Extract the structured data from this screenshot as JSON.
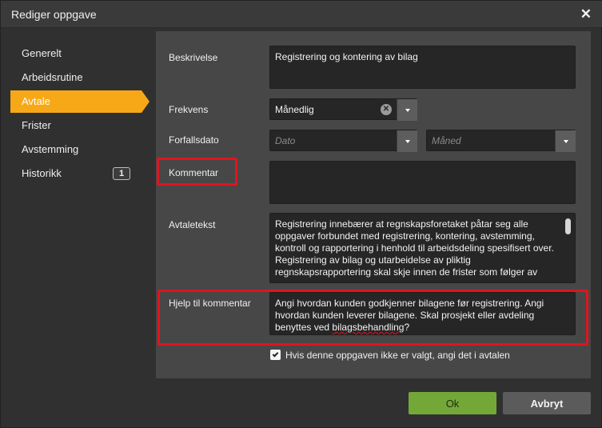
{
  "dialog": {
    "title": "Rediger oppgave"
  },
  "sidebar": {
    "items": [
      {
        "label": "Generelt"
      },
      {
        "label": "Arbeidsrutine"
      },
      {
        "label": "Avtale"
      },
      {
        "label": "Frister"
      },
      {
        "label": "Avstemming"
      },
      {
        "label": "Historikk",
        "badge": "1"
      }
    ],
    "active_index": 2
  },
  "form": {
    "beskrivelse": {
      "label": "Beskrivelse",
      "value": "Registrering og kontering av bilag"
    },
    "frekvens": {
      "label": "Frekvens",
      "value": "Månedlig"
    },
    "forfallsdato": {
      "label": "Forfallsdato",
      "day_placeholder": "Dato",
      "month_placeholder": "Måned"
    },
    "kommentar": {
      "label": "Kommentar",
      "value": ""
    },
    "avtaletekst": {
      "label": "Avtaletekst",
      "value": "Registrering innebærer at regnskapsforetaket påtar seg alle oppgaver forbundet med registrering, kontering, avstemming, kontroll og rapportering i henhold til arbeidsdeling spesifisert over. Registrering av bilag og utarbeidelse av pliktig regnskapsrapportering skal skje innen de frister som følger av"
    },
    "hjelp": {
      "label": "Hjelp til kommentar",
      "text_before": "Angi hvordan kunden godkjenner bilagene før registrering.  Angi hvordan kunden leverer bilagene.  Skal prosjekt eller avdeling benyttes ved ",
      "text_misspelled": "bilagsbehandling",
      "text_after": "?"
    },
    "checkbox": {
      "label": "Hvis denne oppgaven ikke er valgt, angi det i avtalen",
      "checked": true
    }
  },
  "buttons": {
    "ok": "Ok",
    "cancel": "Avbryt"
  },
  "colors": {
    "accent": "#f7a817",
    "highlight": "#e0141f",
    "ok_button": "#73a839"
  }
}
